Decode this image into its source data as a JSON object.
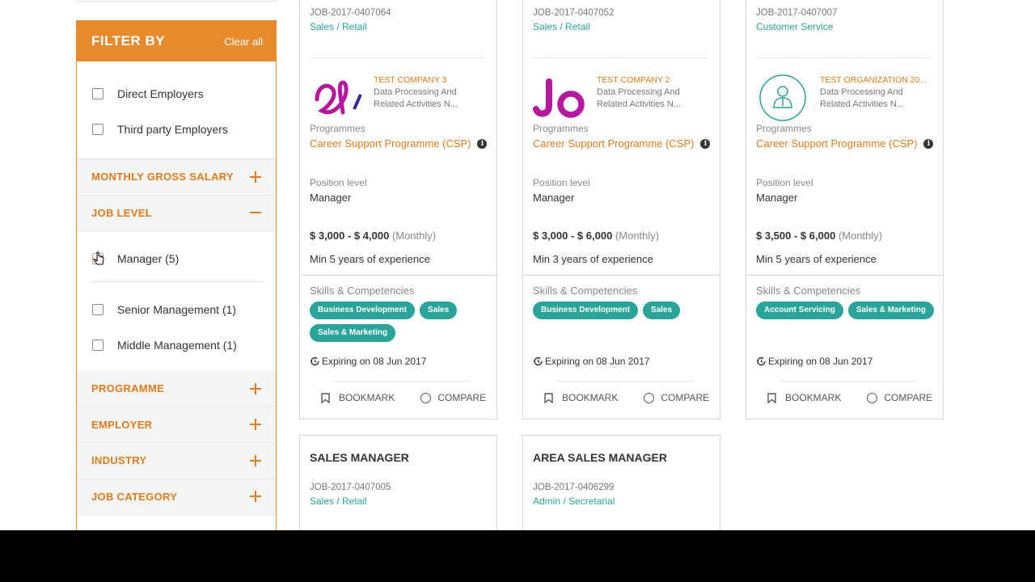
{
  "sidebar": {
    "title": "FILTER BY",
    "clear_all": "Clear all",
    "employer_types": [
      {
        "label": "Direct Employers",
        "checked": false
      },
      {
        "label": "Third party Employers",
        "checked": false
      }
    ],
    "sections": {
      "monthly_salary": "MONTHLY GROSS SALARY",
      "job_level": "JOB LEVEL",
      "programme": "PROGRAMME",
      "employer": "EMPLOYER",
      "industry": "INDUSTRY",
      "job_category": "JOB CATEGORY"
    },
    "job_levels": [
      {
        "label": "Manager (5)",
        "checked": true
      },
      {
        "label": "Senior Management (1)",
        "checked": false
      },
      {
        "label": "Middle Management (1)",
        "checked": false
      }
    ]
  },
  "cards": [
    {
      "code": "JOB-2017-0407064",
      "category": "Sales / Retail",
      "company": "TEST COMPANY 3",
      "company_desc": "Data Processing And Related Activities N...",
      "programmes_label": "Programmes",
      "programme": "Career Support Programme (CSP)",
      "position_label": "Position level",
      "position": "Manager",
      "salary": "$ 3,000 - $ 4,000",
      "period": "(Monthly)",
      "experience": "Min 5 years of experience",
      "skills_label": "Skills & Competencies",
      "tags": [
        "Business Development",
        "Sales",
        "Sales & Marketing"
      ],
      "expiry": "Expiring on 08 Jun 2017",
      "bookmark": "BOOKMARK",
      "compare": "COMPARE"
    },
    {
      "code": "JOB-2017-0407052",
      "category": "Sales / Retail",
      "company": "TEST COMPANY 2",
      "company_desc": "Data Processing And Related Activities N...",
      "programmes_label": "Programmes",
      "programme": "Career Support Programme (CSP)",
      "position_label": "Position level",
      "position": "Manager",
      "salary": "$ 3,000 - $ 6,000",
      "period": "(Monthly)",
      "experience": "Min 3 years of experience",
      "skills_label": "Skills & Competencies",
      "tags": [
        "Business Development",
        "Sales"
      ],
      "expiry": "Expiring on 08 Jun 2017",
      "bookmark": "BOOKMARK",
      "compare": "COMPARE"
    },
    {
      "code": "JOB-2017-0407007",
      "category": "Customer Service",
      "company": "TEST ORGANIZATION 20...",
      "company_desc": "Data Processing And Related Activities N...",
      "programmes_label": "Programmes",
      "programme": "Career Support Programme (CSP)",
      "position_label": "Position level",
      "position": "Manager",
      "salary": "$ 3,500 - $ 6,000",
      "period": "(Monthly)",
      "experience": "Min 5 years of experience",
      "skills_label": "Skills & Competencies",
      "tags": [
        "Account Servicing",
        "Sales & Marketing"
      ],
      "expiry": "Expiring on 08 Jun 2017",
      "bookmark": "BOOKMARK",
      "compare": "COMPARE"
    }
  ],
  "bottom_cards": [
    {
      "title": "SALES MANAGER",
      "code": "JOB-2017-0407005",
      "category": "Sales / Retail"
    },
    {
      "title": "AREA SALES MANAGER",
      "code": "JOB-2017-0406299",
      "category": "Admin / Secretarial"
    }
  ],
  "colors": {
    "accent": "#e8892c",
    "teal": "#2aa39a",
    "logo_purple": "#b5179e"
  }
}
